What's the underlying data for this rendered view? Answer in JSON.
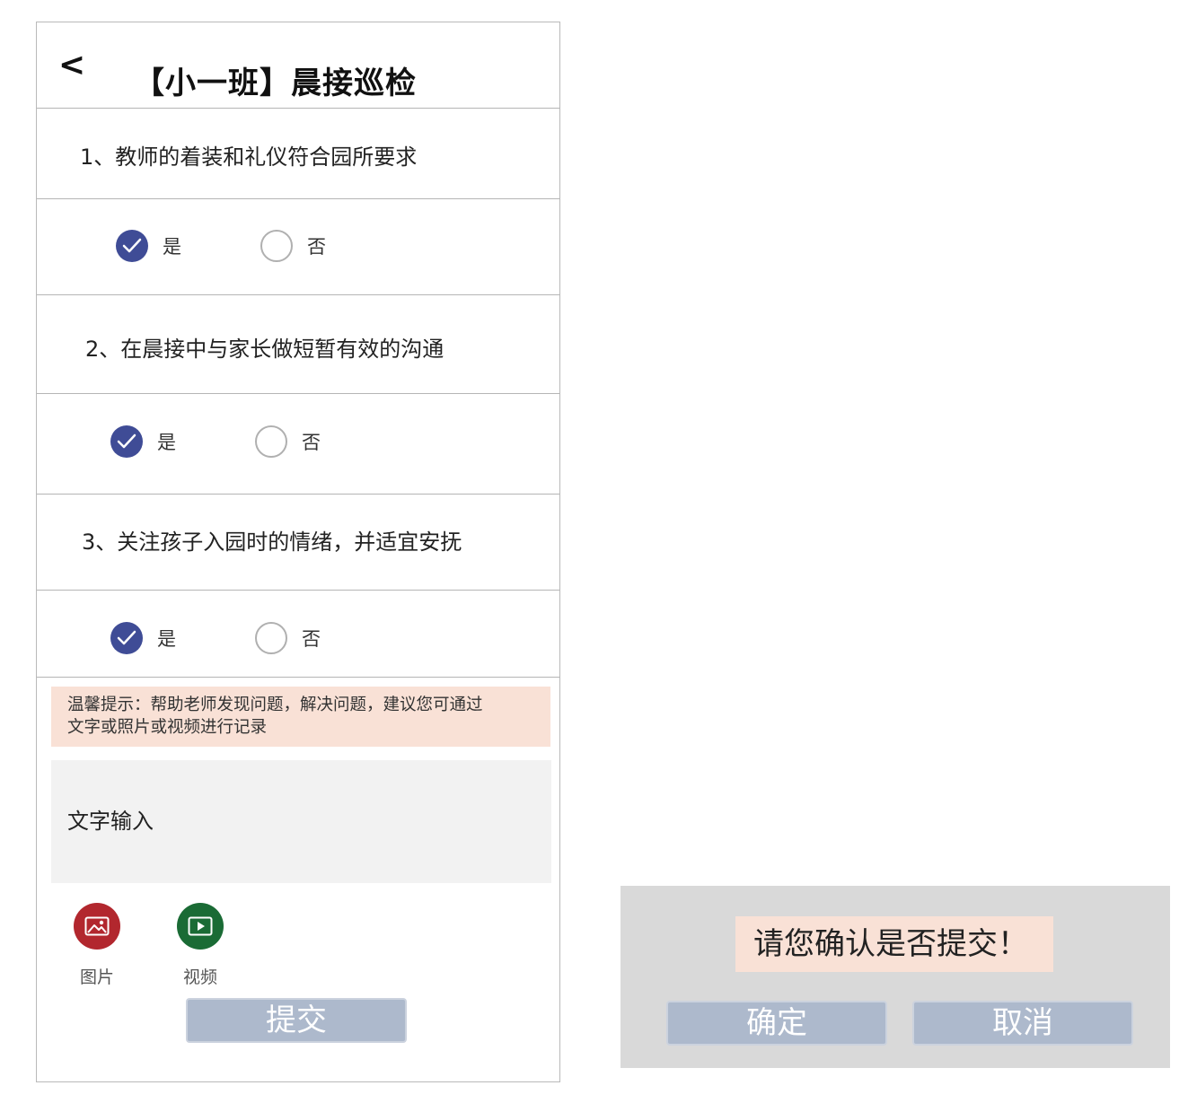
{
  "header": {
    "back_glyph": "<",
    "title": "【小一班】晨接巡检"
  },
  "questions": [
    {
      "text": "1、教师的着装和礼仪符合园所要求",
      "yes_label": "是",
      "no_label": "否",
      "selected": "是"
    },
    {
      "text": "2、在晨接中与家长做短暂有效的沟通",
      "yes_label": "是",
      "no_label": "否",
      "selected": "是"
    },
    {
      "text": "3、关注孩子入园时的情绪，并适宜安抚",
      "yes_label": "是",
      "no_label": "否",
      "selected": "是"
    }
  ],
  "tip": {
    "line1": "温馨提示：帮助老师发现问题，解决问题，建议您可通过",
    "line2": "文字或照片或视频进行记录"
  },
  "text_input": {
    "placeholder": "文字输入"
  },
  "media": [
    {
      "label": "图片",
      "icon": "image-icon",
      "color": "#b2272e"
    },
    {
      "label": "视频",
      "icon": "video-icon",
      "color": "#1a6b35"
    }
  ],
  "submit_label": "提交",
  "dialog": {
    "message": "请您确认是否提交！",
    "confirm_label": "确定",
    "cancel_label": "取消"
  },
  "colors": {
    "accent": "#3f4c96",
    "tip_bg": "#f9e1d6",
    "button_bg": "#adb9cc",
    "dialog_bg": "#d9d9d9"
  }
}
